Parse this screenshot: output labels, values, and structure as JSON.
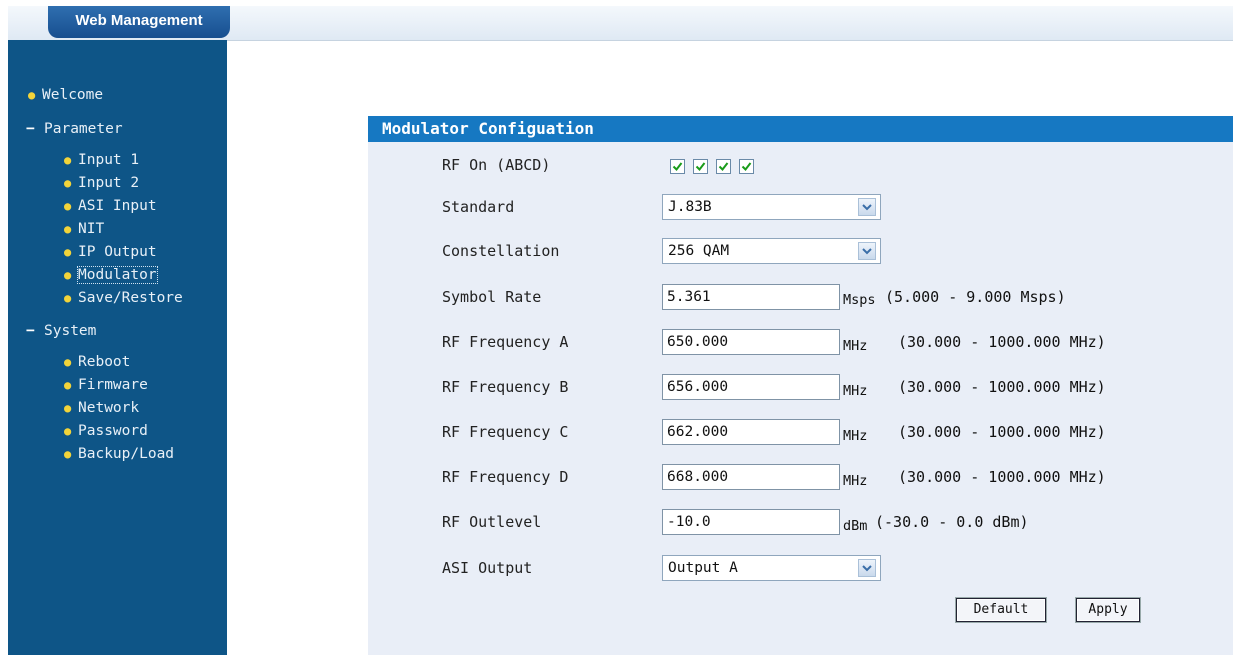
{
  "header": {
    "tab_label": "Web Management"
  },
  "nav": {
    "welcome": "Welcome",
    "parameter": "Parameter",
    "parameter_items": [
      "Input 1",
      "Input 2",
      "ASI Input",
      "NIT",
      "IP Output",
      "Modulator",
      "Save/Restore"
    ],
    "system": "System",
    "system_items": [
      "Reboot",
      "Firmware",
      "Network",
      "Password",
      "Backup/Load"
    ],
    "active_item": "Modulator"
  },
  "panel": {
    "title": "Modulator Configuation",
    "rf_on": {
      "label": "RF On (ABCD)",
      "checked": [
        true,
        true,
        true,
        true
      ]
    },
    "standard": {
      "label": "Standard",
      "value": "J.83B"
    },
    "constellation": {
      "label": "Constellation",
      "value": "256 QAM"
    },
    "symbol_rate": {
      "label": "Symbol Rate",
      "value": "5.361",
      "unit": "Msps",
      "range": "(5.000 - 9.000 Msps)"
    },
    "rf_freq_a": {
      "label": "RF Frequency A",
      "value": "650.000",
      "unit": "MHz",
      "range": "(30.000 - 1000.000 MHz)"
    },
    "rf_freq_b": {
      "label": "RF Frequency B",
      "value": "656.000",
      "unit": "MHz",
      "range": "(30.000 - 1000.000 MHz)"
    },
    "rf_freq_c": {
      "label": "RF Frequency C",
      "value": "662.000",
      "unit": "MHz",
      "range": "(30.000 - 1000.000 MHz)"
    },
    "rf_freq_d": {
      "label": "RF Frequency D",
      "value": "668.000",
      "unit": "MHz",
      "range": "(30.000 - 1000.000 MHz)"
    },
    "rf_outlevel": {
      "label": "RF Outlevel",
      "value": "-10.0",
      "unit": "dBm",
      "range": "(-30.0 - 0.0 dBm)"
    },
    "asi_output": {
      "label": "ASI Output",
      "value": "Output A"
    },
    "default_button": "Default",
    "apply_button": "Apply"
  },
  "colors": {
    "sidebar": "#0e5587",
    "panel_title_bar": "#1678c2",
    "panel_bg": "#e9eef7",
    "bullet": "#f2d43a",
    "checkmark": "#1a9c1a"
  }
}
